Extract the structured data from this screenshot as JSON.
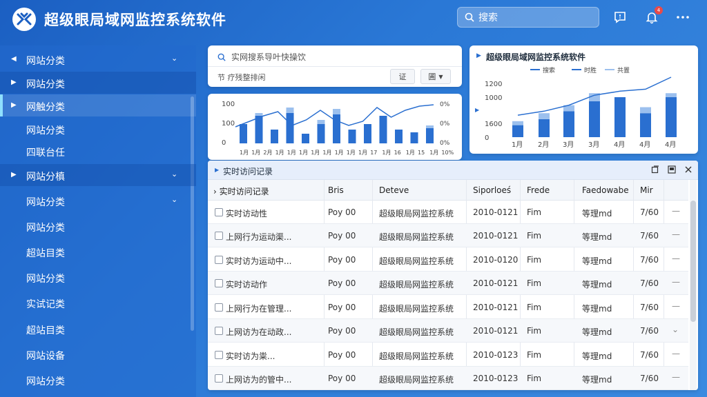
{
  "header": {
    "title": "超级眼局域网监控系统软件",
    "search_label": "搜索",
    "notification_count": "4"
  },
  "sidebar": {
    "items": [
      {
        "label": "网站分类",
        "arrow": "◀",
        "chevron": "⌄"
      },
      {
        "label": "网站分类",
        "arrow": "▶",
        "chevron": ""
      },
      {
        "label": "网触分类",
        "arrow": "▶",
        "chevron": ""
      },
      {
        "label": "网站分类",
        "arrow": "",
        "chevron": ""
      },
      {
        "label": "四联台任",
        "arrow": "",
        "chevron": ""
      },
      {
        "label": "网站分槙",
        "arrow": "▶",
        "chevron": "⌄"
      },
      {
        "label": "网站分类",
        "arrow": "",
        "chevron": "⌄"
      },
      {
        "label": "网站分类",
        "arrow": "",
        "chevron": ""
      },
      {
        "label": "超站目类",
        "arrow": "",
        "chevron": ""
      },
      {
        "label": "网站分类",
        "arrow": "",
        "chevron": ""
      },
      {
        "label": "实试记类",
        "arrow": "",
        "chevron": ""
      },
      {
        "label": "超站目类",
        "arrow": "",
        "chevron": ""
      },
      {
        "label": "网站设备",
        "arrow": "",
        "chevron": ""
      },
      {
        "label": "网站分类",
        "arrow": "",
        "chevron": ""
      }
    ]
  },
  "quick_search": {
    "placeholder": "实网搜系导叶快操饮",
    "filter_label": "节 疗残整排闲",
    "btn1": "证",
    "btn2": "圃"
  },
  "mini_chart": {
    "y_left": [
      "100",
      "100",
      "0"
    ],
    "y_right": [
      "0%",
      "0%",
      "0%"
    ],
    "x_labels": [
      "1月",
      "1月",
      "2月",
      "1月",
      "1月",
      "1月",
      "1月",
      "1月",
      "1月",
      "1月",
      "1月",
      "17",
      "1月",
      "16",
      "1月",
      "15",
      "1月",
      "10%"
    ]
  },
  "chart_data": {
    "type": "bar",
    "title": "超级眼局域网监控系统软件",
    "legend": [
      "搜索",
      "时胜",
      "共置"
    ],
    "categories": [
      "1月",
      "2月",
      "3月",
      "3月",
      "4月",
      "4月",
      "4月"
    ],
    "y_ticks": [
      "1200",
      "1000",
      "1600",
      "0"
    ],
    "series": [
      {
        "name": "搜索",
        "values": [
          300,
          450,
          650,
          900,
          1000,
          600,
          1000
        ]
      },
      {
        "name": "时胜",
        "values": [
          100,
          150,
          150,
          200,
          0,
          150,
          100
        ]
      }
    ],
    "line": [
      550,
      650,
      800,
      1050,
      1150,
      1200,
      1500
    ]
  },
  "panel": {
    "title": "实时访问记录",
    "columns": [
      "实时访问记录",
      "Bris",
      "Deteve",
      "Siporloeś",
      "Frede",
      "Faedowabe",
      "Mir"
    ],
    "rows": [
      {
        "name": "实时访动性",
        "c2": "Poy 00",
        "c3": "超级眼局网监控系统",
        "c4": "2010-0121",
        "c5": "Fim",
        "c6": "等理md",
        "c7": "7/60",
        "more": "—"
      },
      {
        "name": "上网行为运动渠...",
        "c2": "Poy 00",
        "c3": "超级眼局网监控系统",
        "c4": "2010-0121",
        "c5": "Fim",
        "c6": "等理md",
        "c7": "7/60",
        "more": "—"
      },
      {
        "name": "实时访为运动中...",
        "c2": "Poy 00",
        "c3": "超级眼局网监控系统",
        "c4": "2010-0120",
        "c5": "Fim",
        "c6": "等理md",
        "c7": "7/60",
        "more": "—"
      },
      {
        "name": "实时访动作",
        "c2": "Poy 00",
        "c3": "超级眼局网监控系统",
        "c4": "2010-0121",
        "c5": "Fim",
        "c6": "等理md",
        "c7": "7/60",
        "more": "—"
      },
      {
        "name": "上网行为在管理...",
        "c2": "Poy 00",
        "c3": "超级眼局网监控系统",
        "c4": "2010-0121",
        "c5": "Fim",
        "c6": "等理md",
        "c7": "7/60",
        "more": "—"
      },
      {
        "name": "上网访为在动政...",
        "c2": "Poy 00",
        "c3": "超级眼局网监控系统",
        "c4": "2010-0121",
        "c5": "Fim",
        "c6": "等理md",
        "c7": "7/60",
        "more": "⌄"
      },
      {
        "name": "实时访为粜...",
        "c2": "Poy 00",
        "c3": "超级眼局网监控系统",
        "c4": "2010-0123",
        "c5": "Fim",
        "c6": "等理md",
        "c7": "7/60",
        "more": "—"
      },
      {
        "name": "上网访为的管中...",
        "c2": "Poy 00",
        "c3": "超级眼局网监控系统",
        "c4": "2010-0123",
        "c5": "Fim",
        "c6": "等理md",
        "c7": "7/60",
        "more": "—"
      }
    ]
  },
  "colors": {
    "accent": "#2a6fd0",
    "bar_light": "#9cc0ee",
    "bg": "#2a78d6"
  }
}
